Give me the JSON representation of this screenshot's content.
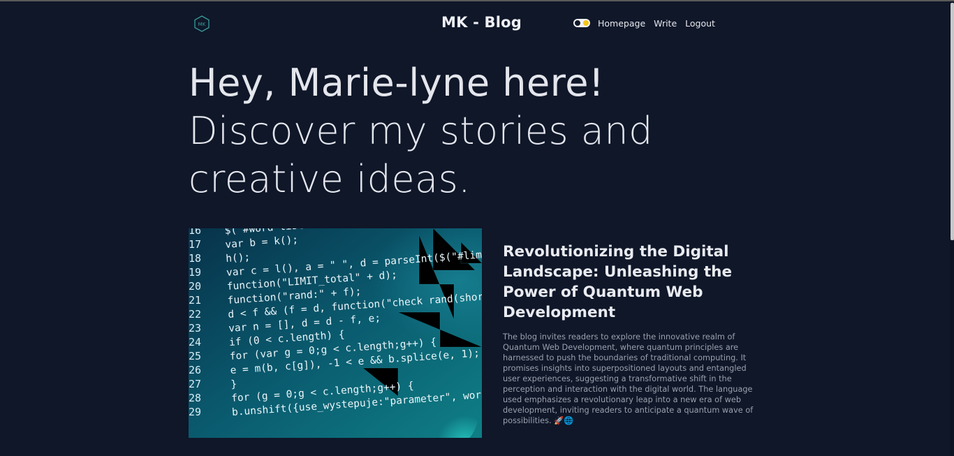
{
  "header": {
    "logo_text": "MK",
    "site_title": "MK - Blog",
    "nav": {
      "homepage": "Homepage",
      "write": "Write",
      "logout": "Logout"
    }
  },
  "hero": {
    "line1": "Hey, Marie-lyne here!",
    "line2": "Discover my stories and",
    "line3": "creative ideas."
  },
  "featured_post": {
    "image_icon": "code-screenshot-image",
    "title": "Revolutionizing the Digital Landscape: Unleashing the Power of Quantum Web Development",
    "description": "The blog invites readers to explore the innovative realm of Quantum Web Development, where quantum principles are harnessed to push the boundaries of traditional computing. It promises insights into superpositioned layouts and entangled user experiences, suggesting a transformative shift in the perception and interaction with the digital world. The language used emphasizes a revolutionary leap into a new era of web development, inviting readers to anticipate a quantum wave of possibilities. 🚀🌐",
    "code_lines": [
      {
        "n": "16",
        "code": "$(\"#word-list-out\").e(\" \");"
      },
      {
        "n": "17",
        "code": "var b = k();"
      },
      {
        "n": "18",
        "code": "h();"
      },
      {
        "n": "19",
        "code": "var c = l(), a = \" \", d = parseInt($(\"#limit_val\"));"
      },
      {
        "n": "20",
        "code": "function(\"LIMIT_total\" + d);"
      },
      {
        "n": "21",
        "code": "function(\"rand:\" + f);"
      },
      {
        "n": "22",
        "code": "d < f && (f = d, function(\"check rand(short)\");"
      },
      {
        "n": "23",
        "code": "var n = [], d = d - f, e;"
      },
      {
        "n": "24",
        "code": "if (0 < c.length) {"
      },
      {
        "n": "25",
        "code": "  for (var g = 0;g < c.length;g++) {"
      },
      {
        "n": "26",
        "code": "    e = m(b, c[g]), -1 < e && b.splice(e, 1);"
      },
      {
        "n": "27",
        "code": "  }"
      },
      {
        "n": "28",
        "code": "  for (g = 0;g < c.length;g++) {"
      },
      {
        "n": "29",
        "code": "    b.unshift({use_wystepuje:\"parameter\", words:c[g]});"
      }
    ]
  },
  "colors": {
    "background": "#0f1729",
    "text": "#e4e6ec",
    "muted_text": "#9aa1ad",
    "logo_accent": "#3a9c9c",
    "toggle_sun": "#f5c518"
  },
  "theme_toggle": {
    "icon": "theme-toggle-icon"
  }
}
